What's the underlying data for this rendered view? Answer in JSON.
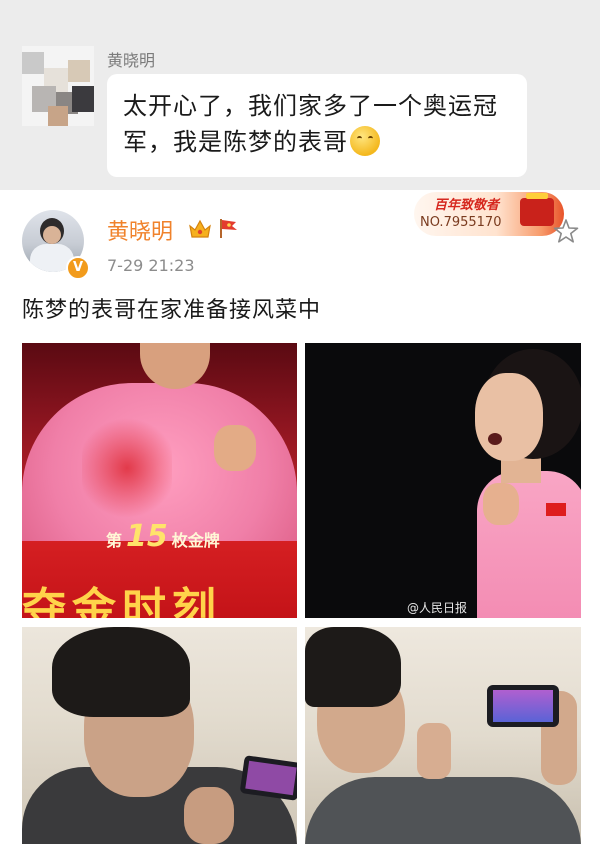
{
  "chat": {
    "sender_name": "黄晓明",
    "message": "太开心了，我们家多了一个奥运冠军，我是陈梦的表哥",
    "emoji": "shy-smile-emoji"
  },
  "post": {
    "author": "黄晓明",
    "verified_badge": "V",
    "time": "7-29 21:23",
    "text": "陈梦的表哥在家准备接风菜中",
    "fan_badge": {
      "title": "百年致敬者",
      "number": "NO.7955170"
    },
    "icons": [
      "crown-icon",
      "flag-icon",
      "star-icon"
    ]
  },
  "photos": {
    "photo1_caption_prefix": "第",
    "photo1_caption_number": "15",
    "photo1_caption_suffix": "枚金牌",
    "photo1_banner": "夺金时刻",
    "photo2_watermark": "@人民日报"
  },
  "colors": {
    "chat_background": "#ececec",
    "author_name": "#f0822b",
    "verified_badge": "#f29b1b",
    "muted_text": "#8c8c8c"
  }
}
